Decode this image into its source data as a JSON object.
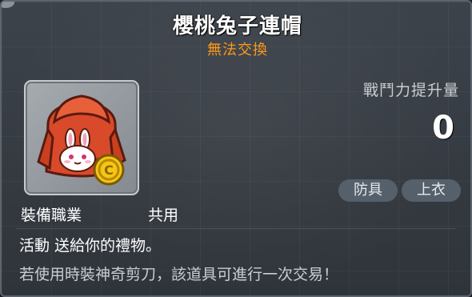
{
  "item": {
    "name": "櫻桃兔子連帽",
    "trade_status": "無法交換",
    "icon": "red-bunny-hoodie-icon"
  },
  "stats": {
    "power_label": "戰鬥力提升量",
    "power_value": "0"
  },
  "tags": [
    "防具",
    "上衣"
  ],
  "requirement": {
    "label": "裝備職業",
    "value": "共用"
  },
  "description": {
    "line1": "活動 送給你的禮物。",
    "line2": "若使用時裝神奇剪刀，該道具可進行一次交易！"
  },
  "colors": {
    "trade_status": "#ff9a17",
    "panel": "#363b42",
    "tag": "#55606b"
  }
}
